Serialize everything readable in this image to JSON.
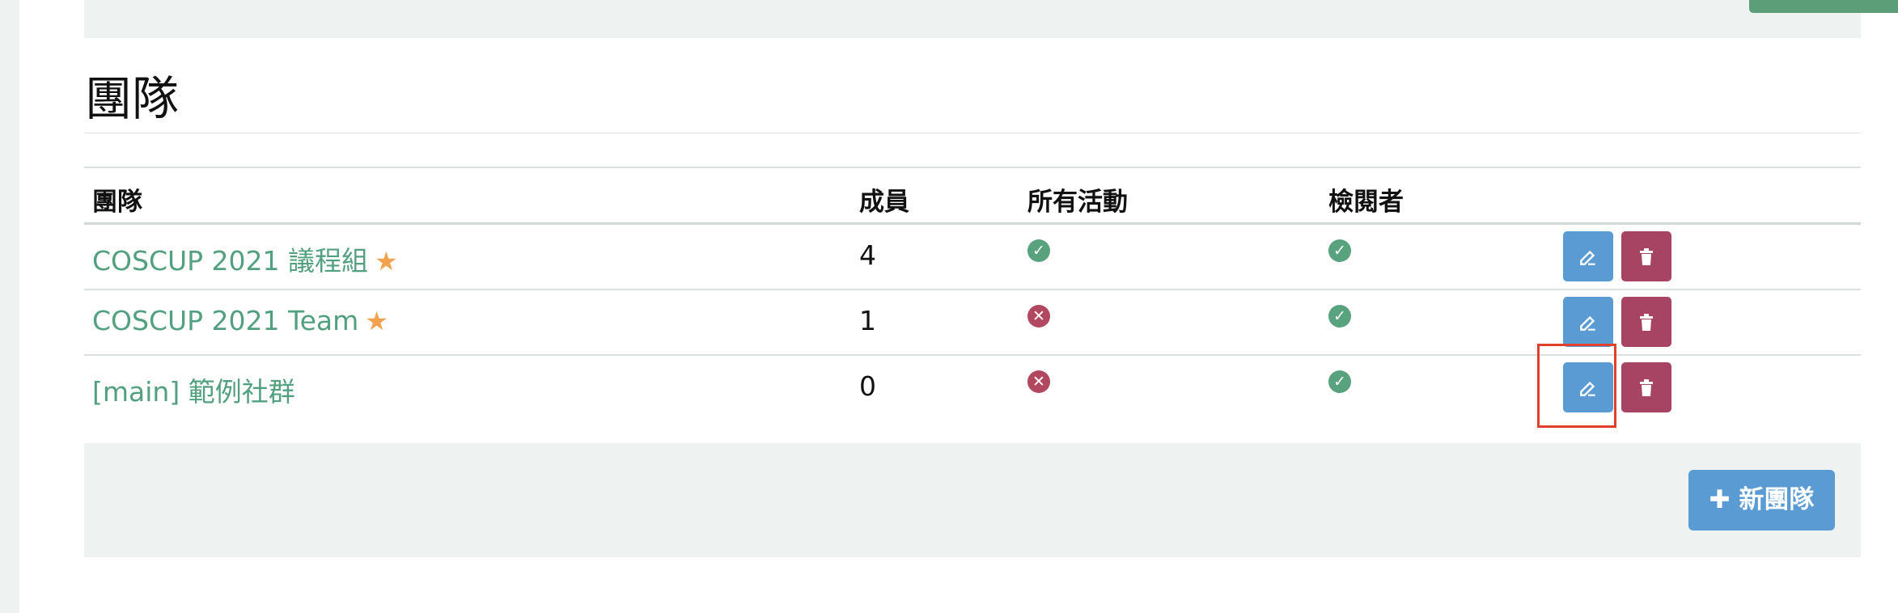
{
  "section": {
    "title": "團隊"
  },
  "table": {
    "headers": {
      "team": "團隊",
      "members": "成員",
      "all_events": "所有活動",
      "reviewer": "檢閱者"
    },
    "rows": [
      {
        "name": "COSCUP 2021 議程組",
        "starred": true,
        "members": "4",
        "all_events": "yes",
        "reviewer": "yes"
      },
      {
        "name": "COSCUP 2021 Team",
        "starred": true,
        "members": "1",
        "all_events": "no",
        "reviewer": "yes"
      },
      {
        "name": "[main] 範例社群",
        "starred": false,
        "members": "0",
        "all_events": "no",
        "reviewer": "yes"
      }
    ]
  },
  "icons": {
    "star": "star-icon",
    "yes": "check-circle-icon",
    "no": "x-circle-icon",
    "edit": "edit-icon",
    "delete": "trash-icon",
    "add": "plus-icon"
  },
  "footer": {
    "new_team_label": "新團隊"
  },
  "colors": {
    "link": "#52a07f",
    "star": "#f2a24e",
    "ok": "#58a27e",
    "no": "#b24760",
    "edit_button": "#5b9bd3",
    "delete_button": "#a84463",
    "highlight": "#e0412c"
  }
}
